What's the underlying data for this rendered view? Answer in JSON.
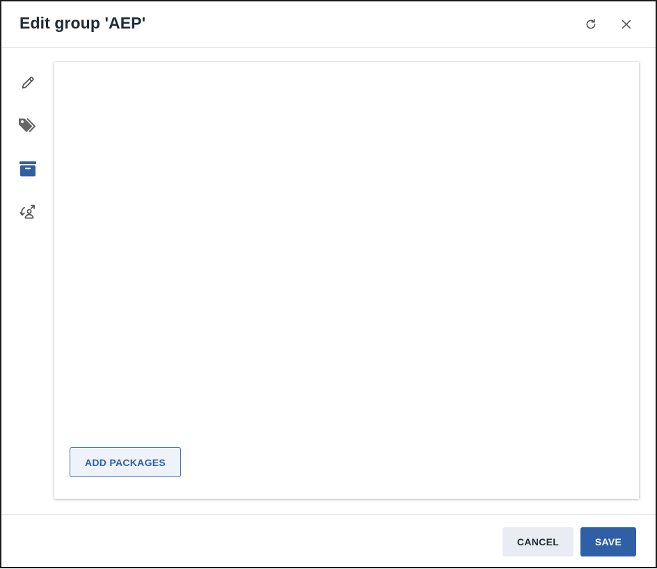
{
  "dialog": {
    "title": "Edit group 'AEP'",
    "header_icons": [
      "refresh-icon",
      "close-icon"
    ]
  },
  "sidebar": {
    "items": [
      {
        "icon": "pencil-icon",
        "active": false
      },
      {
        "icon": "tags-icon",
        "active": false
      },
      {
        "icon": "archive-box-icon",
        "active": true
      },
      {
        "icon": "sync-user-icon",
        "active": false
      }
    ]
  },
  "panel": {
    "add_packages_label": "ADD PACKAGES"
  },
  "footer": {
    "cancel_label": "CANCEL",
    "save_label": "SAVE"
  },
  "colors": {
    "accent": "#2f5fa5",
    "icon_gray": "#666666",
    "title_text": "#1f2a37",
    "secondary_button_bg": "#e9edf3"
  }
}
